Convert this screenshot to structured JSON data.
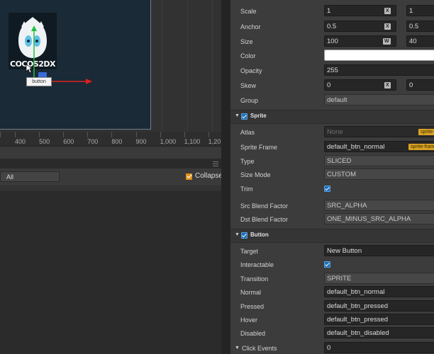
{
  "scene": {
    "node_label": "button",
    "logo_text": "COCOS2DX",
    "ruler_ticks": [
      "400",
      "500",
      "600",
      "700",
      "800",
      "900",
      "1,000",
      "1,100",
      "1,20"
    ]
  },
  "hierarchy": {
    "filter_value": "All",
    "collapse_label": "Collapse",
    "collapse_checked": true
  },
  "properties": {
    "scale": {
      "label": "Scale",
      "x": "1",
      "x_tag": "X",
      "y": "1"
    },
    "anchor": {
      "label": "Anchor",
      "x": "0.5",
      "x_tag": "X",
      "y": "0.5"
    },
    "size": {
      "label": "Size",
      "w": "100",
      "w_tag": "W",
      "h": "40"
    },
    "color": {
      "label": "Color",
      "value": "#FFFFFF"
    },
    "opacity": {
      "label": "Opacity",
      "value": "255"
    },
    "skew": {
      "label": "Skew",
      "x": "0",
      "x_tag": "X",
      "y": "0"
    },
    "group": {
      "label": "Group",
      "value": "default"
    }
  },
  "sprite": {
    "section_title": "Sprite",
    "enabled": true,
    "atlas": {
      "label": "Atlas",
      "value": "None",
      "tag": "sprite-"
    },
    "sprite_frame": {
      "label": "Sprite Frame",
      "value": "default_btn_normal",
      "tag": "sprite-fram"
    },
    "type": {
      "label": "Type",
      "value": "SLICED"
    },
    "size_mode": {
      "label": "Size Mode",
      "value": "CUSTOM"
    },
    "trim": {
      "label": "Trim",
      "checked": true
    },
    "src_blend": {
      "label": "Src Blend Factor",
      "value": "SRC_ALPHA"
    },
    "dst_blend": {
      "label": "Dst Blend Factor",
      "value": "ONE_MINUS_SRC_ALPHA"
    }
  },
  "button": {
    "section_title": "Button",
    "enabled": true,
    "target": {
      "label": "Target",
      "value": "New Button"
    },
    "interactable": {
      "label": "Interactable",
      "checked": true
    },
    "transition": {
      "label": "Transition",
      "value": "SPRITE"
    },
    "normal": {
      "label": "Normal",
      "value": "default_btn_normal"
    },
    "pressed": {
      "label": "Pressed",
      "value": "default_btn_pressed"
    },
    "hover": {
      "label": "Hover",
      "value": "default_btn_pressed"
    },
    "disabled": {
      "label": "Disabled",
      "value": "default_btn_disabled"
    },
    "click_events": {
      "label": "Click Events",
      "value": "0"
    }
  },
  "colors": {
    "canvas_bg": "#1A2A36",
    "accent_checkbox": "#1D6FB5",
    "asset_tag": "#D8A324",
    "gizmo_x": "#E02020",
    "gizmo_y": "#20C040"
  }
}
